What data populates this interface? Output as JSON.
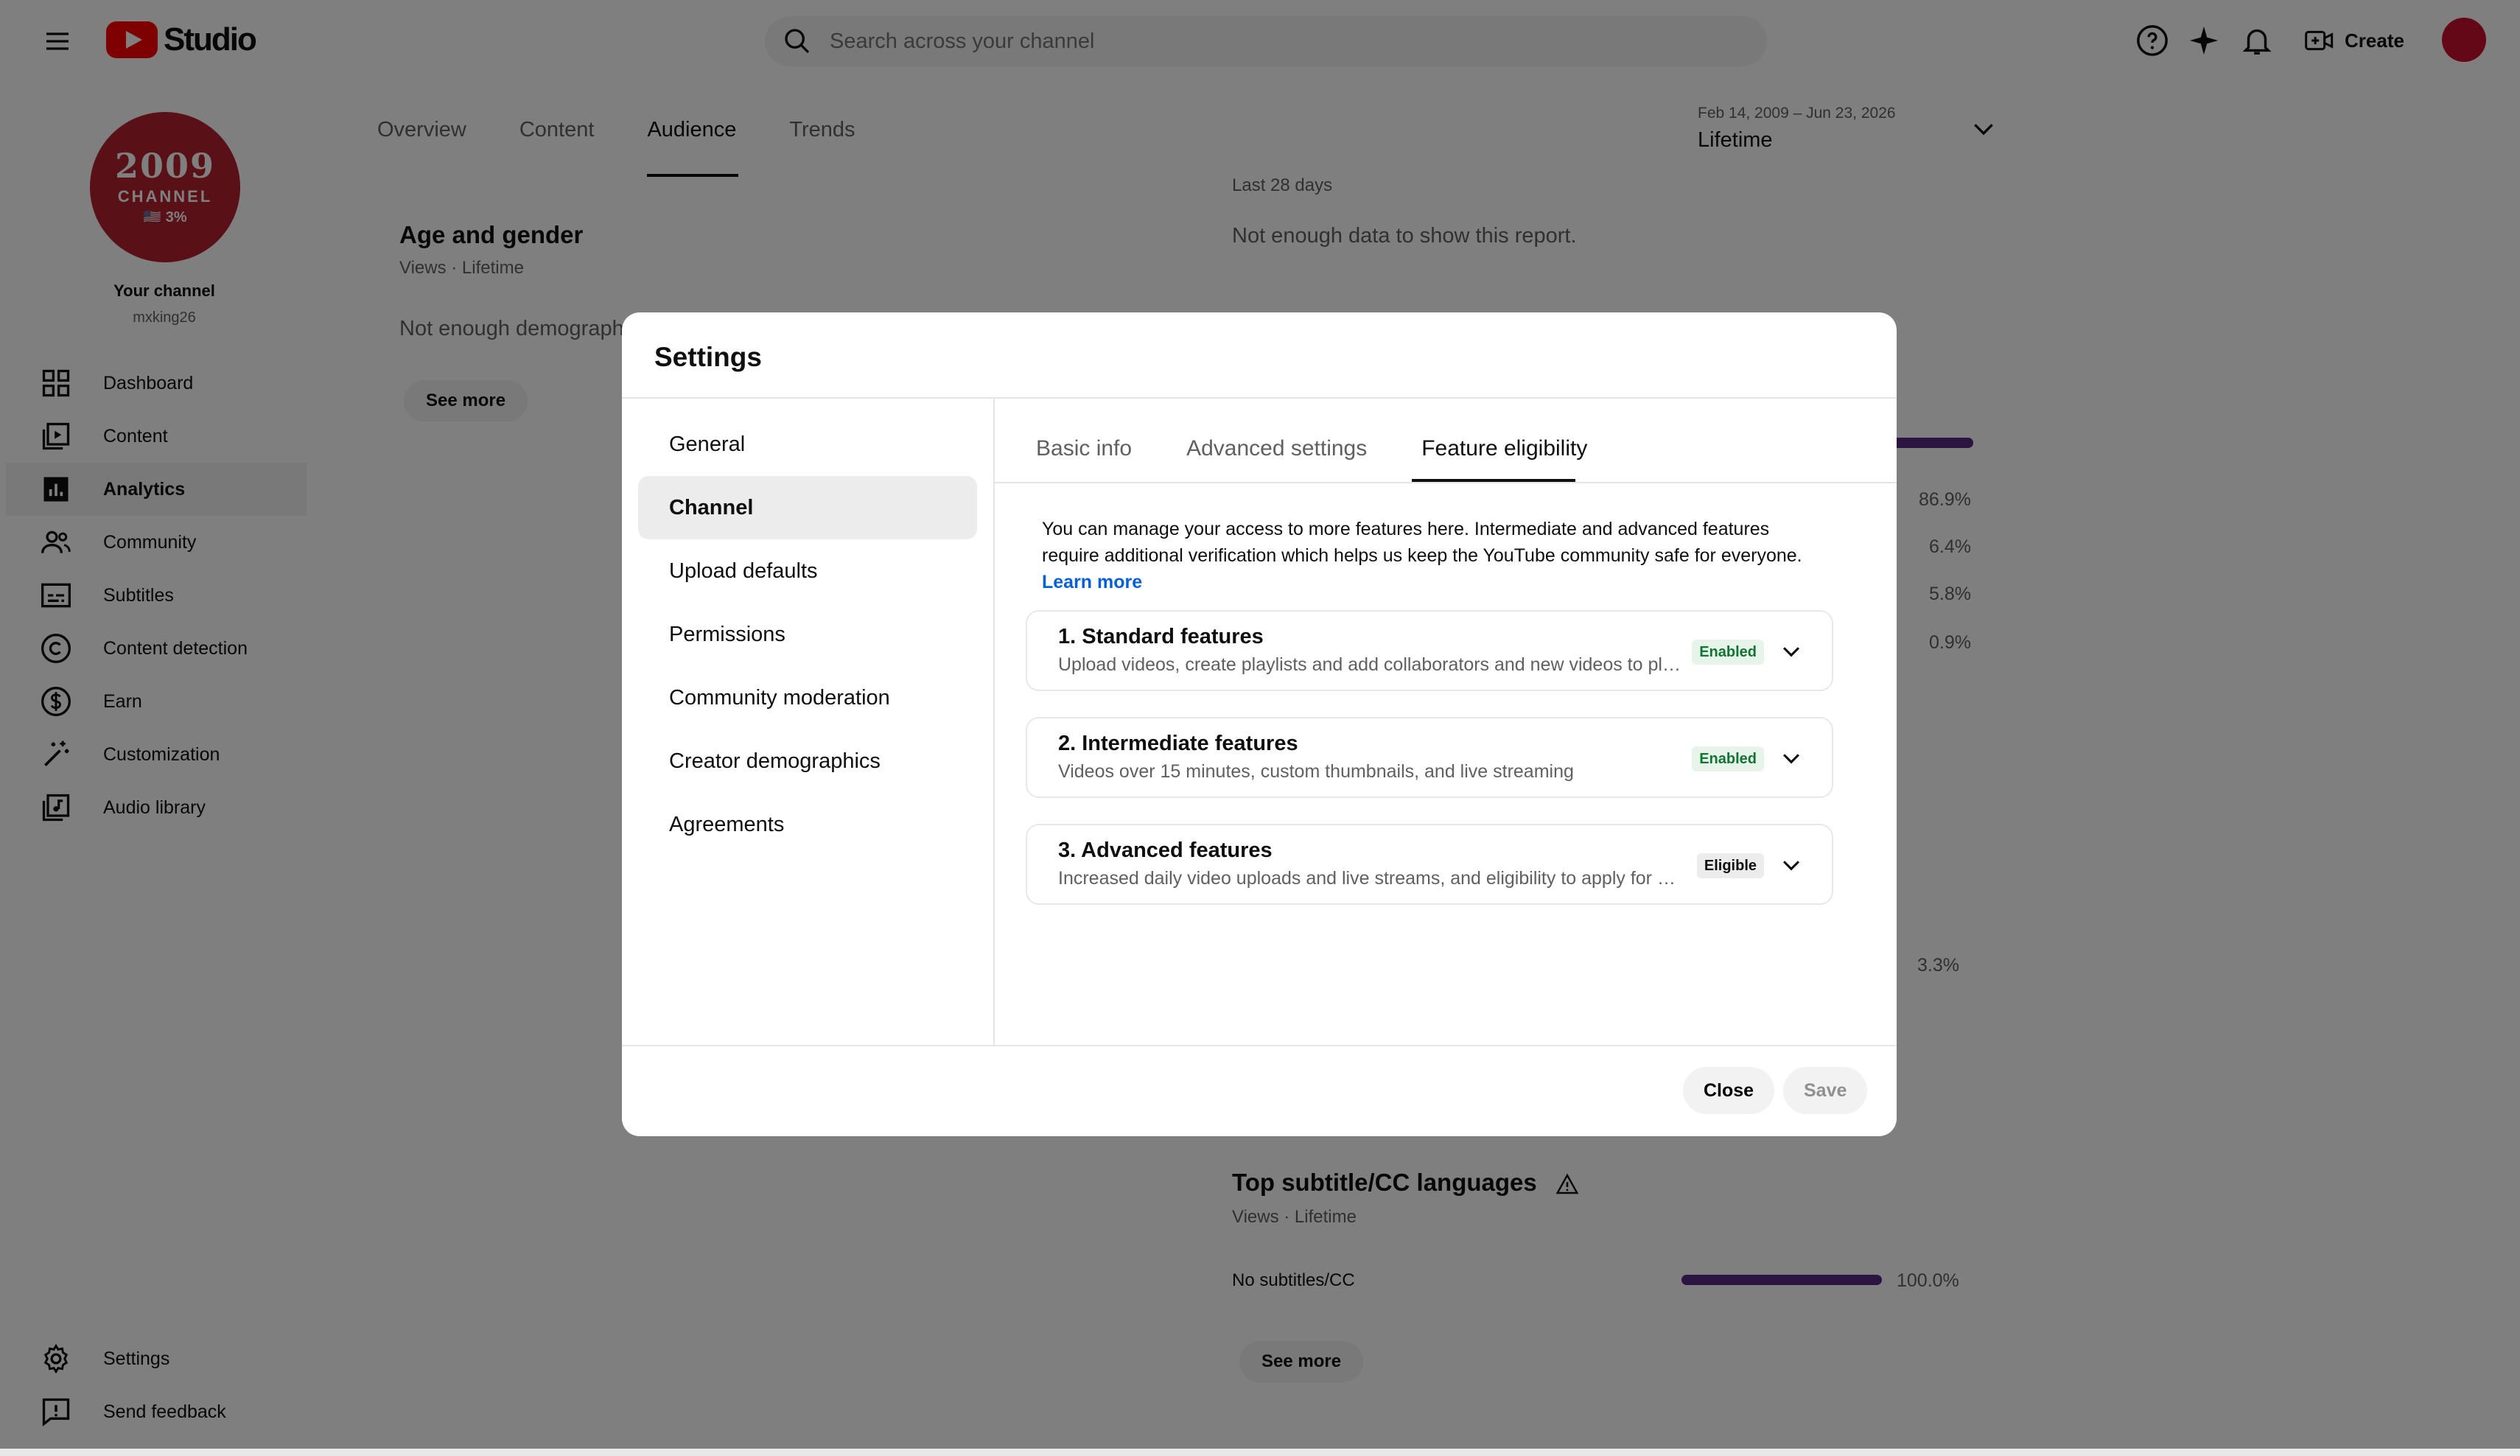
{
  "header": {
    "logo_text": "Studio",
    "search_placeholder": "Search across your channel",
    "create_label": "Create"
  },
  "sidebar": {
    "avatar_lines": [
      "2009",
      "CHANNEL",
      "🇺🇸 3%"
    ],
    "your_channel": "Your channel",
    "handle": "mxking26",
    "items": [
      {
        "label": "Dashboard",
        "icon": "dashboard-icon"
      },
      {
        "label": "Content",
        "icon": "content-icon"
      },
      {
        "label": "Analytics",
        "icon": "analytics-icon"
      },
      {
        "label": "Community",
        "icon": "community-icon"
      },
      {
        "label": "Subtitles",
        "icon": "subtitles-icon"
      },
      {
        "label": "Content detection",
        "icon": "copyright-icon"
      },
      {
        "label": "Earn",
        "icon": "dollar-icon"
      },
      {
        "label": "Customization",
        "icon": "wand-icon"
      },
      {
        "label": "Audio library",
        "icon": "audio-library-icon"
      }
    ],
    "bottom_items": [
      {
        "label": "Settings",
        "icon": "gear-icon"
      },
      {
        "label": "Send feedback",
        "icon": "feedback-icon"
      }
    ]
  },
  "main": {
    "tabs": [
      "Overview",
      "Content",
      "Audience",
      "Trends"
    ],
    "active_tab": "Audience",
    "date_range": "Feb 14, 2009 – Jun 23, 2026",
    "date_preset": "Lifetime",
    "last_28_days": "Last 28 days",
    "not_enough_data": "Not enough data to show this report.",
    "age_gender": {
      "title": "Age and gender",
      "subtitle": "Views · Lifetime",
      "text": "Not enough demographic",
      "see_more": "See more"
    },
    "right_pcts": [
      "86.9%",
      "6.4%",
      "5.8%",
      "0.9%",
      "3.3%"
    ],
    "subtitle_card": {
      "title": "Top subtitle/CC languages",
      "subtitle": "Views · Lifetime",
      "row_label": "No subtitles/CC",
      "row_pct": "100.0%",
      "row_value": 100.0,
      "see_more": "See more"
    }
  },
  "dialog": {
    "title": "Settings",
    "nav": [
      "General",
      "Channel",
      "Upload defaults",
      "Permissions",
      "Community moderation",
      "Creator demographics",
      "Agreements"
    ],
    "active_nav": "Channel",
    "tabs": [
      "Basic info",
      "Advanced settings",
      "Feature eligibility"
    ],
    "active_tab": "Feature eligibility",
    "description": "You can manage your access to more features here. Intermediate and advanced features require additional verification which helps us keep the YouTube community safe for everyone.",
    "learn_more": "Learn more",
    "features": [
      {
        "title": "1. Standard features",
        "desc": "Upload videos, create playlists and add collaborators and new videos to playlists",
        "badge": "Enabled"
      },
      {
        "title": "2. Intermediate features",
        "desc": "Videos over 15 minutes, custom thumbnails, and live streaming",
        "badge": "Enabled"
      },
      {
        "title": "3. Advanced features",
        "desc": "Increased daily video uploads and live streams, and eligibility to apply for monetization",
        "badge": "Eligible"
      }
    ],
    "close_label": "Close",
    "save_label": "Save"
  },
  "colors": {
    "brand_red": "#ff0000",
    "bar_purple": "#5b2a86",
    "link_blue": "#065fd4",
    "enabled_green": "#137333"
  }
}
